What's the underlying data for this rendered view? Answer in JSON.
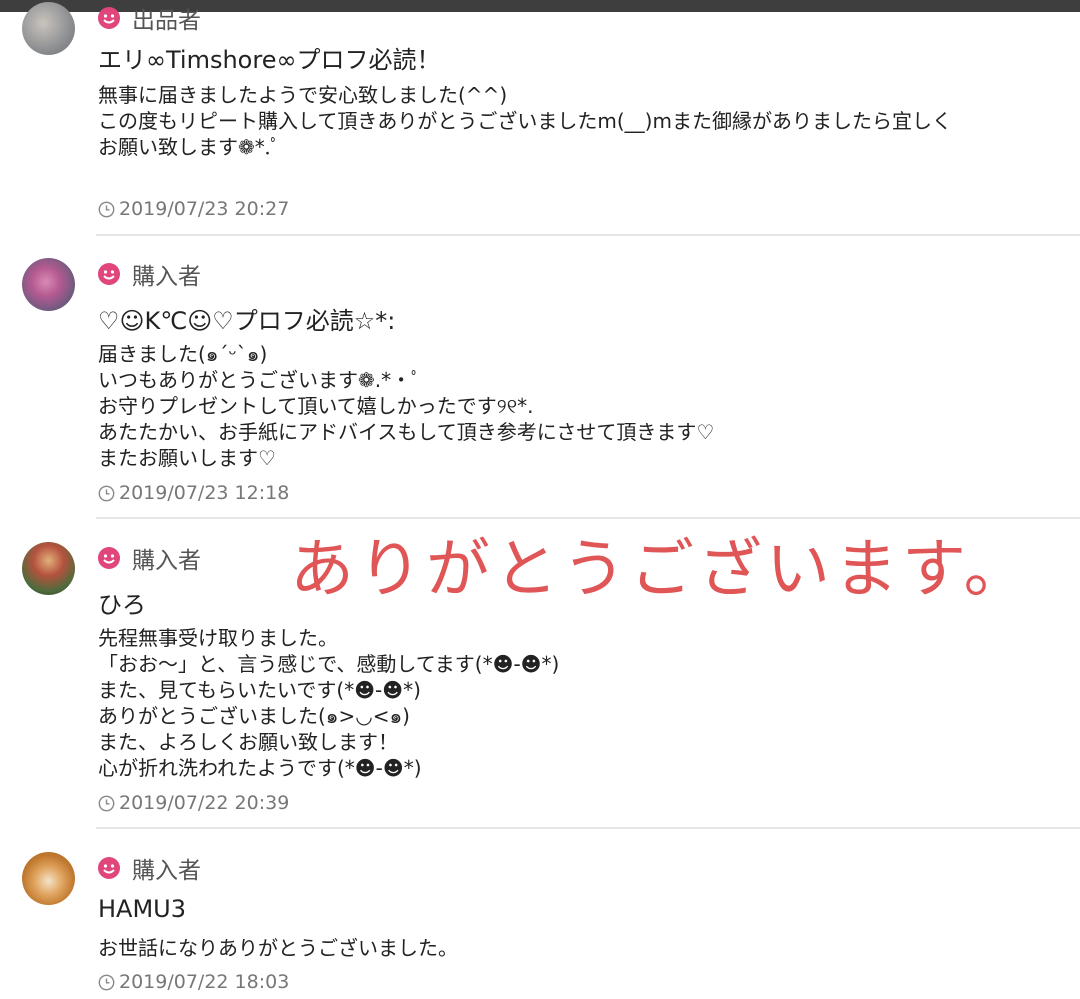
{
  "overlay_text": "ありがとうございます。",
  "reviews": [
    {
      "role": "出品者",
      "username": "エリ∞Timshore∞プロフ必読！",
      "message_lines": [
        "無事に届きましたようで安心致しました(^^)",
        "この度もリピート購入して頂きありがとうございましたm(__)mまた御縁がありましたら宜しく",
        "お願い致します❁*.ﾟ"
      ],
      "timestamp": "2019/07/23 20:27"
    },
    {
      "role": "購入者",
      "username": "♡☺K℃☺♡プロフ必読☆*:",
      "message_lines": [
        "届きました(๑ˊᵕˋ๑)",
        "いつもありがとうございます❁.*・ﾟ",
        "お守りプレゼントして頂いて嬉しかったです୨୧*.",
        "あたたかい、お手紙にアドバイスもして頂き参考にさせて頂きます♡",
        "またお願いします♡"
      ],
      "timestamp": "2019/07/23 12:18"
    },
    {
      "role": "購入者",
      "username": "ひろ",
      "message_lines": [
        "先程無事受け取りました。",
        "「おお〜」と、言う感じで、感動してます(*☻-☻*)",
        "また、見てもらいたいです(*☻-☻*)",
        "ありがとうございました(๑>◡<๑)",
        "また、よろしくお願い致します！",
        "心が折れ洗われたようです(*☻-☻*)"
      ],
      "timestamp": "2019/07/22 20:39"
    },
    {
      "role": "購入者",
      "username": "HAMU3",
      "message_lines": [
        "お世話になりありがとうございました。"
      ],
      "timestamp": "2019/07/22 18:03"
    }
  ],
  "colors": {
    "role_icon": "#e0457b",
    "overlay": "#e05555",
    "divider": "#e6e6e6"
  },
  "icons": {
    "role": "smiley-face-icon",
    "time": "clock-icon"
  }
}
